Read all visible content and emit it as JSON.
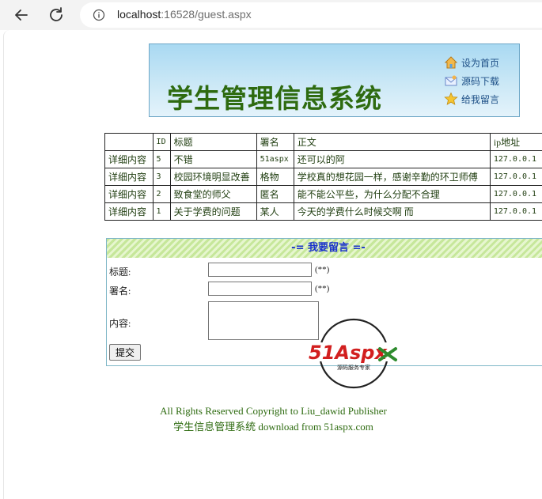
{
  "browser": {
    "url_host": "localhost",
    "url_rest": ":16528/guest.aspx",
    "icons": [
      "back-arrow-icon",
      "reload-icon",
      "info-icon"
    ]
  },
  "banner": {
    "title": "学生管理信息系统",
    "links": [
      {
        "label": "设为首页",
        "icon": "home-icon"
      },
      {
        "label": "源码下载",
        "icon": "envelope-icon"
      },
      {
        "label": "给我留言",
        "icon": "star-icon"
      }
    ]
  },
  "messages_table": {
    "headers": [
      "",
      "ID",
      "标题",
      "署名",
      "正文",
      "ip地址"
    ],
    "rows": [
      [
        "详细内容",
        "5",
        "不错",
        "51aspx",
        "还可以的阿",
        "127.0.0.1"
      ],
      [
        "详细内容",
        "3",
        "校园环境明显改善",
        "格物",
        "学校真的想花园一样，感谢辛勤的环卫师傅",
        "127.0.0.1"
      ],
      [
        "详细内容",
        "2",
        "致食堂的师父",
        "匿名",
        "能不能公平些，为什么分配不合理",
        "127.0.0.1"
      ],
      [
        "详细内容",
        "1",
        "关于学费的问题",
        "某人",
        "今天的学费什么时候交啊 而",
        "127.0.0.1"
      ]
    ]
  },
  "form": {
    "heading": "-= 我要留言 =-",
    "title_label": "标题:",
    "author_label": "署名:",
    "content_label": "内容:",
    "required_mark": "(**)",
    "title_value": "",
    "author_value": "",
    "content_value": "",
    "submit_label": "提交"
  },
  "watermark": {
    "text": "51Aspx",
    "tagline": "源码服务专家"
  },
  "footer": {
    "line1": "All Rights Reserved    Copyright to Liu_dawid Publisher",
    "line2": "学生信息管理系统 download from 51aspx.com"
  },
  "colors": {
    "banner_title": "#2e6b10",
    "form_heading": "#1b33cc",
    "text_green": "#1f3d0f"
  }
}
